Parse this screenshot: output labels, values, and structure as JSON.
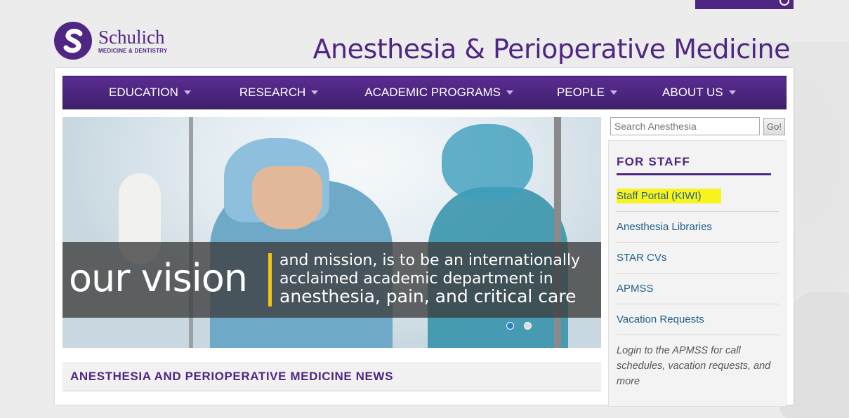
{
  "brand": {
    "name": "Schulich",
    "subtitle": "MEDICINE & DENTISTRY",
    "department": "Anesthesia & Perioperative Medicine",
    "color": "#4f2683"
  },
  "nav": {
    "items": [
      {
        "label": "EDUCATION"
      },
      {
        "label": "RESEARCH"
      },
      {
        "label": "ACADEMIC PROGRAMS"
      },
      {
        "label": "PEOPLE"
      },
      {
        "label": "ABOUT US"
      }
    ],
    "caret_icon": "chevron-down-icon"
  },
  "hero": {
    "headline": "our vision",
    "lines": [
      "and mission, is to be an internationally",
      "acclaimed academic department in",
      "anesthesia, pain, and critical care"
    ],
    "slide_count": 2,
    "active_slide": 1,
    "accent": "#f0c419"
  },
  "news": {
    "title": "ANESTHESIA AND PERIOPERATIVE MEDICINE NEWS"
  },
  "search": {
    "placeholder": "Search Anesthesia",
    "value": "",
    "button_label": "Go!"
  },
  "sidebar": {
    "title": "FOR STAFF",
    "items": [
      {
        "label": "Staff Portal (KIWI)",
        "highlighted": true
      },
      {
        "label": "Anesthesia Libraries"
      },
      {
        "label": "STAR CVs"
      },
      {
        "label": "APMSS"
      },
      {
        "label": "Vacation Requests"
      }
    ],
    "note": "Login to the APMSS for call schedules, vacation requests, and more",
    "link_color": "#1e5f8c",
    "highlight_color": "#f9f31d"
  }
}
